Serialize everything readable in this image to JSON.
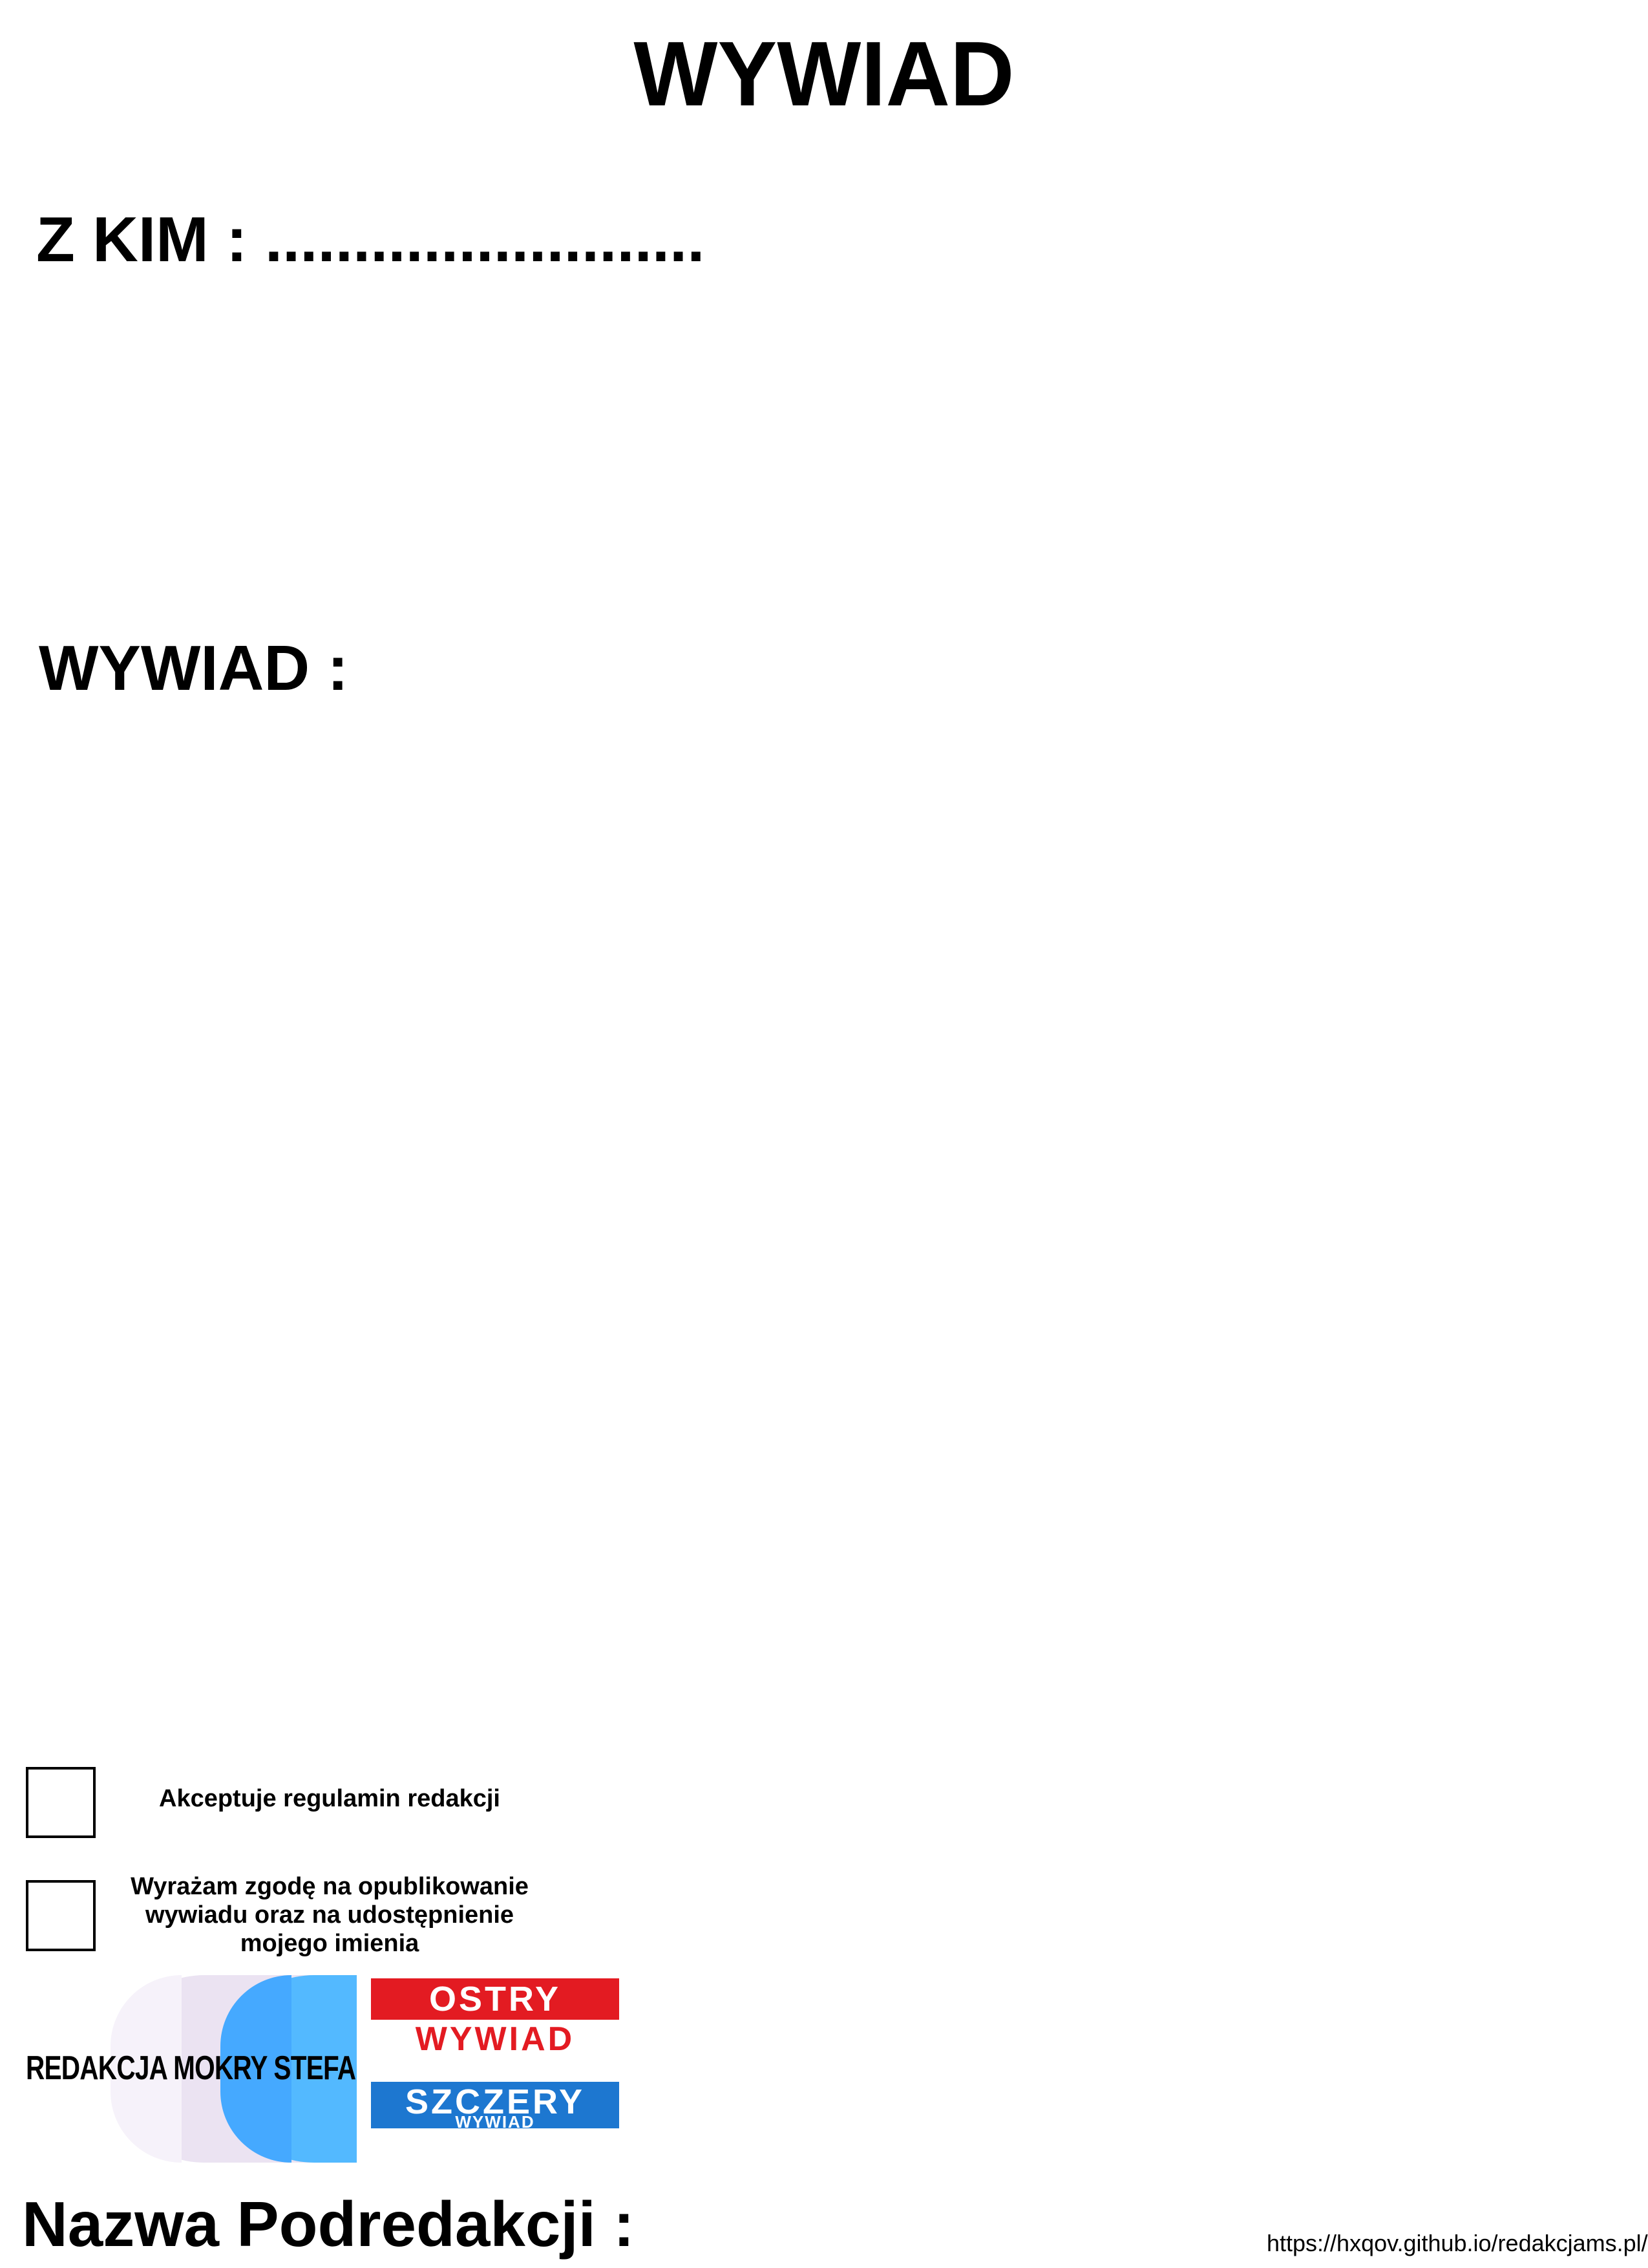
{
  "header": {
    "title": "WYWIAD"
  },
  "interviewee": {
    "label": "Z KIM : ........................."
  },
  "interview": {
    "label": "WYWIAD :"
  },
  "consents": [
    {
      "label": "Akceptuje regulamin redakcji"
    },
    {
      "label": "Wyrażam zgodę na opublikowanie wywiadu oraz na udostępnienie mojego imienia"
    }
  ],
  "logos": {
    "mokry_stefan": "REDAKCJA MOKRY STEFAN",
    "ostry": {
      "top": "OSTRY",
      "bottom": "WYWIAD"
    },
    "szczery": {
      "top": "SZCZERY",
      "bottom": "WYWIAD"
    }
  },
  "footer": {
    "subeditorial_label": "Nazwa Podredakcji :",
    "url": "https://hxqov.github.io/redakcjams.pl/"
  },
  "colors": {
    "red": "#e31b22",
    "blue": "#1d77d0",
    "light_blue": "#53b9ff",
    "lavender": "#ebe3f2"
  }
}
